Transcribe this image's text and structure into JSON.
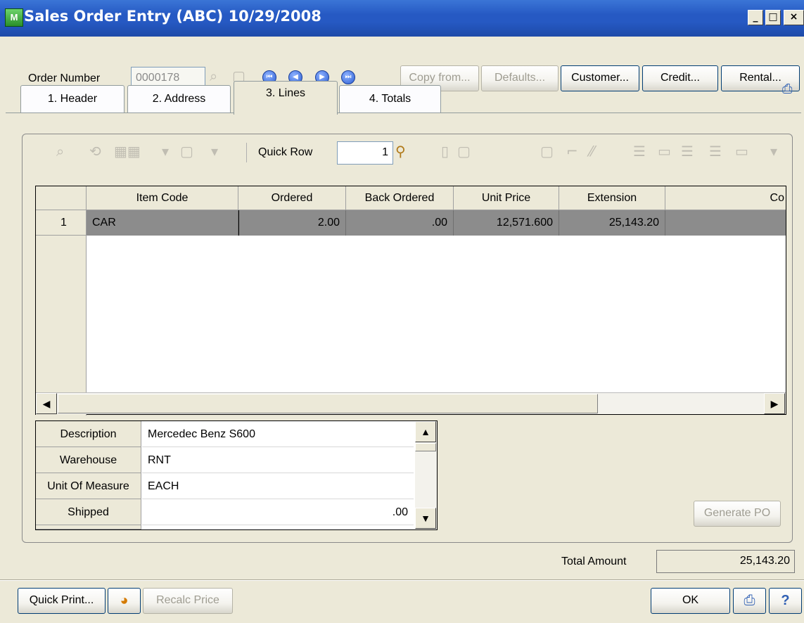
{
  "window": {
    "title": "Sales Order Entry (ABC) 10/29/2008",
    "icon": "app-icon",
    "min": "_",
    "max": "□",
    "close": "×"
  },
  "order": {
    "label": "Order Number",
    "value": "0000178"
  },
  "buttons": {
    "copy_from": "Copy from...",
    "defaults": "Defaults...",
    "customer": "Customer...",
    "credit": "Credit...",
    "rental": "Rental...",
    "generate_po": "Generate PO",
    "quick_print": "Quick Print...",
    "recalc_price": "Recalc Price",
    "ok": "OK"
  },
  "tabs": [
    {
      "label": "1. Header"
    },
    {
      "label": "2. Address"
    },
    {
      "label": "3. Lines",
      "active": true
    },
    {
      "label": "4. Totals"
    }
  ],
  "toolbar": {
    "quick_row_label": "Quick Row",
    "quick_row_value": "1"
  },
  "grid": {
    "columns": [
      "Item Code",
      "Ordered",
      "Back Ordered",
      "Unit Price",
      "Extension",
      "Co"
    ],
    "rows": [
      {
        "num": "1",
        "item_code": "CAR",
        "ordered": "2.00",
        "back_ordered": ".00",
        "unit_price": "12,571.600",
        "extension": "25,143.20"
      }
    ]
  },
  "detail": {
    "rows": [
      {
        "label": "Description",
        "value": "Mercedec Benz S600"
      },
      {
        "label": "Warehouse",
        "value": "RNT"
      },
      {
        "label": "Unit Of Measure",
        "value": "EACH"
      },
      {
        "label": "Shipped",
        "value": ".00"
      }
    ]
  },
  "totals": {
    "label": "Total Amount",
    "value": "25,143.20"
  },
  "colors": {
    "title_bar": "#2659c3",
    "selected_row": "#8c8c8c",
    "window_bg": "#ece9d8"
  }
}
